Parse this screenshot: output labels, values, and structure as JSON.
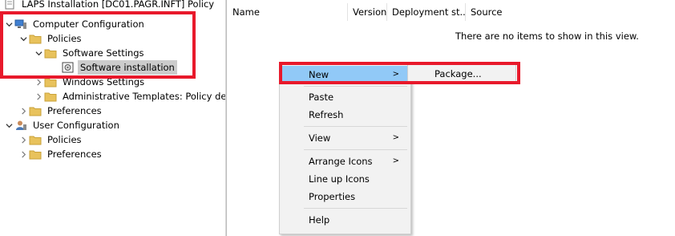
{
  "tree": {
    "items": [
      {
        "label": "LAPS Installation [DC01.PAGR.INFT] Policy",
        "icon": "policy-icon"
      },
      {
        "label": "Computer Configuration",
        "icon": "computer-config-icon"
      },
      {
        "label": "Policies",
        "icon": "folder-icon"
      },
      {
        "label": "Software Settings",
        "icon": "folder-icon"
      },
      {
        "label": "Software installation",
        "icon": "software-installation-icon"
      },
      {
        "label": "Windows Settings",
        "icon": "folder-icon"
      },
      {
        "label": "Administrative Templates: Policy defi",
        "icon": "folder-icon"
      },
      {
        "label": "Preferences",
        "icon": "folder-icon"
      },
      {
        "label": "User Configuration",
        "icon": "user-config-icon"
      },
      {
        "label": "Policies",
        "icon": "folder-icon"
      },
      {
        "label": "Preferences",
        "icon": "folder-icon"
      }
    ]
  },
  "list": {
    "columns": [
      "Name",
      "Version",
      "Deployment st...",
      "Source"
    ],
    "empty_message": "There are no items to show in this view."
  },
  "context_menu": {
    "items": [
      "New",
      "Paste",
      "Refresh",
      "View",
      "Arrange Icons",
      "Line up Icons",
      "Properties",
      "Help"
    ],
    "submenu_arrow": ">"
  },
  "submenu": {
    "items": [
      "Package..."
    ]
  },
  "colors": {
    "highlight": "#91c9f7",
    "annotation": "#e8192b",
    "folder": "#e8c25c"
  }
}
